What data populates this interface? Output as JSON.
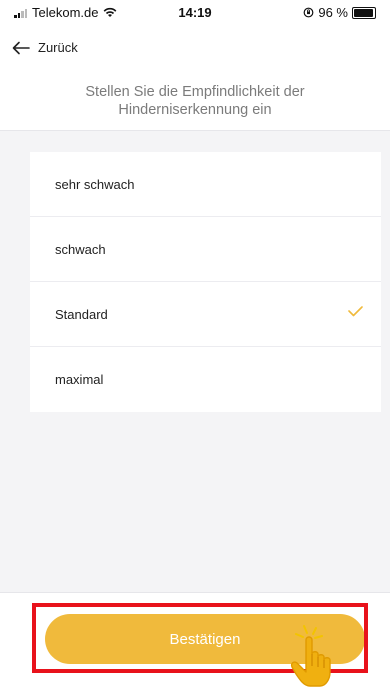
{
  "status_bar": {
    "carrier": "Telekom.de",
    "time": "14:19",
    "battery": "96 %"
  },
  "header": {
    "back_label": "Zurück",
    "title": "Stellen Sie die Empfindlichkeit der Hinderniserkennung ein"
  },
  "options": [
    {
      "label": "sehr schwach",
      "selected": false
    },
    {
      "label": "schwach",
      "selected": false
    },
    {
      "label": "Standard",
      "selected": true
    },
    {
      "label": "maximal",
      "selected": false
    }
  ],
  "footer": {
    "confirm_label": "Bestätigen"
  },
  "colors": {
    "accent": "#f0ba3c",
    "highlight": "#e8121b"
  }
}
